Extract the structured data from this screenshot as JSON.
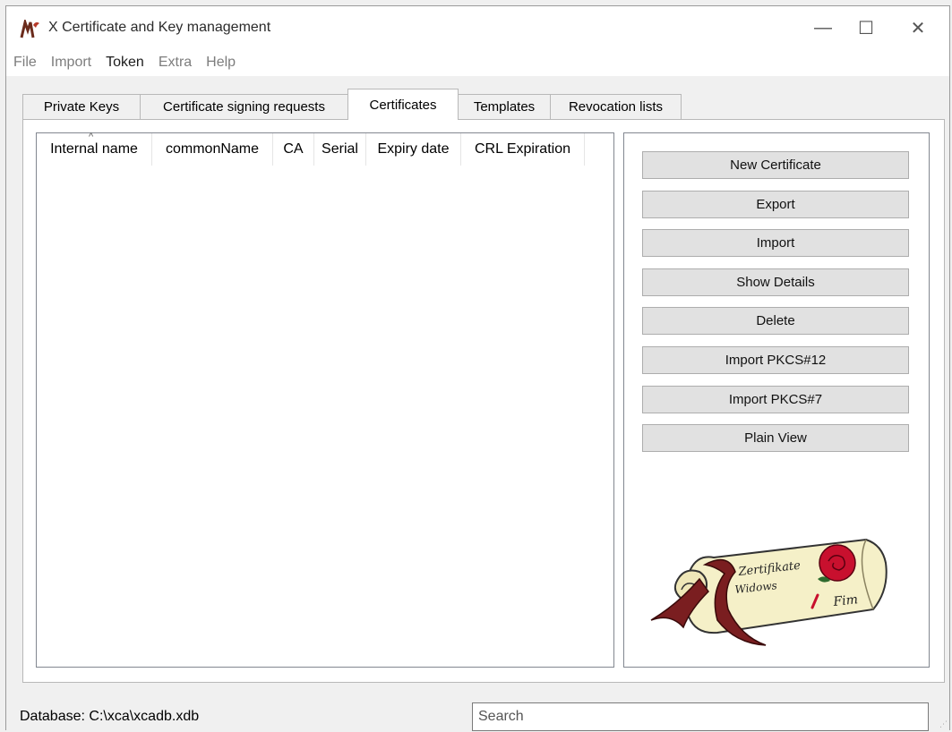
{
  "window": {
    "title": "X Certificate and Key management",
    "controls": {
      "minimize": "—",
      "maximize": "☐",
      "close": "✕"
    }
  },
  "menu": [
    {
      "label": "File",
      "active": false
    },
    {
      "label": "Import",
      "active": false
    },
    {
      "label": "Token",
      "active": true
    },
    {
      "label": "Extra",
      "active": false
    },
    {
      "label": "Help",
      "active": false
    }
  ],
  "tabs": [
    {
      "label": "Private Keys",
      "selected": false
    },
    {
      "label": "Certificate signing requests",
      "selected": false
    },
    {
      "label": "Certificates",
      "selected": true
    },
    {
      "label": "Templates",
      "selected": false
    },
    {
      "label": "Revocation lists",
      "selected": false
    }
  ],
  "table": {
    "sorted_column": "Internal name",
    "columns": [
      "Internal name",
      "commonName",
      "CA",
      "Serial",
      "Expiry date",
      "CRL Expiration"
    ],
    "rows": []
  },
  "buttons": [
    "New Certificate",
    "Export",
    "Import",
    "Show Details",
    "Delete",
    "Import PKCS#12",
    "Import PKCS#7",
    "Plain View"
  ],
  "logo": {
    "line1": "Zertifikate",
    "line2": "Widows",
    "line3": "Fim"
  },
  "status": {
    "database": "Database: C:\\xca\\xcadb.xdb",
    "search_placeholder": "Search"
  },
  "colors": {
    "scroll_ribbon": "#7a1e20",
    "rose": "#c8102e",
    "parchment": "#f5f0c8"
  }
}
